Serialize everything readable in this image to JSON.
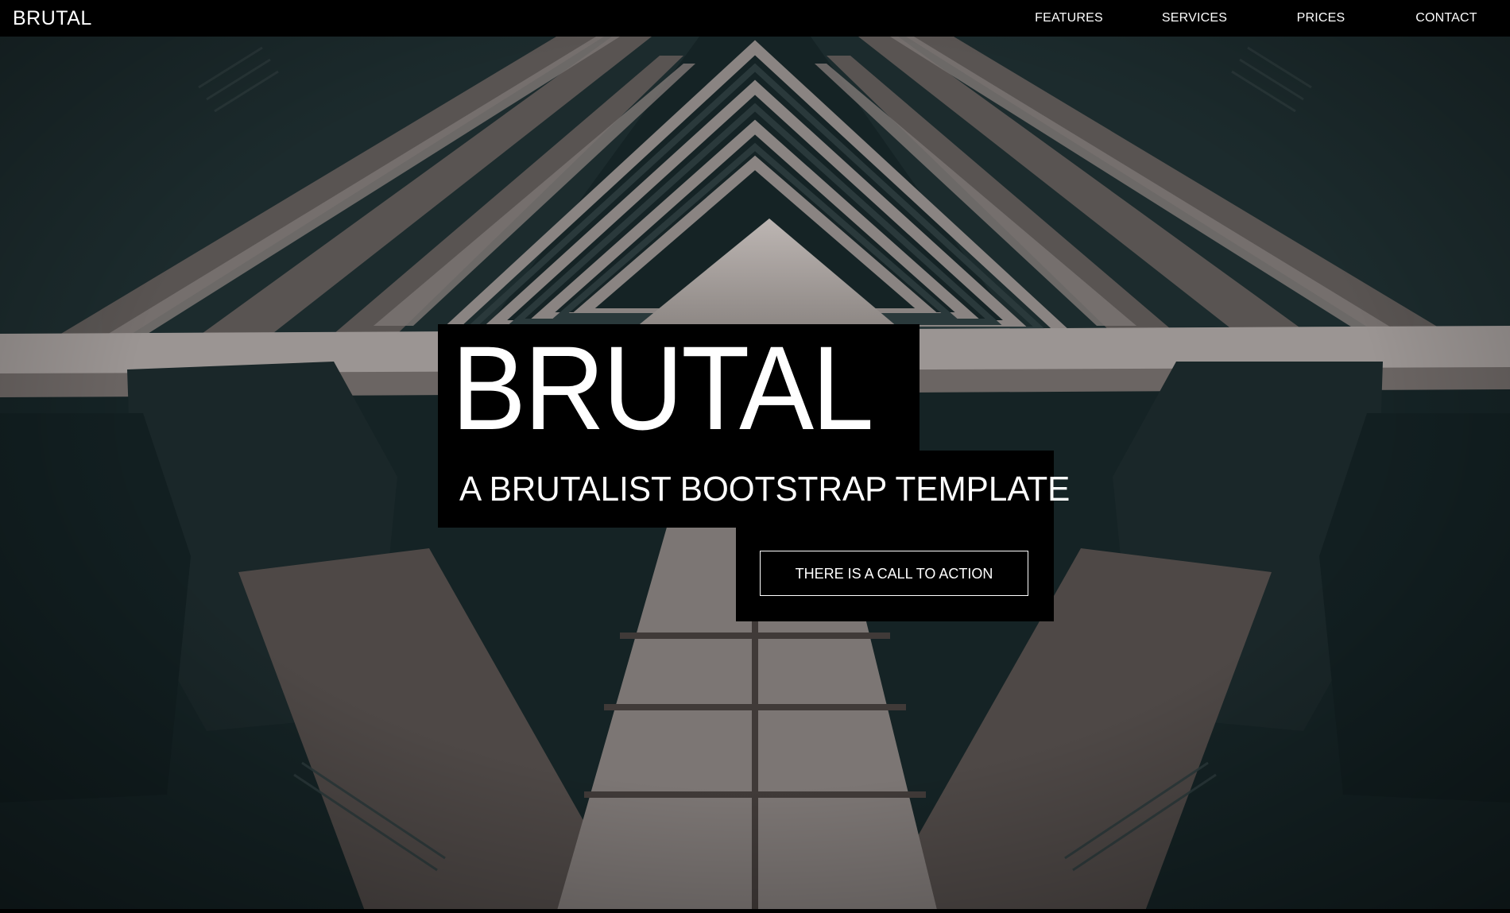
{
  "navbar": {
    "brand": "BRUTAL",
    "links": [
      {
        "label": "FEATURES"
      },
      {
        "label": "SERVICES"
      },
      {
        "label": "PRICES"
      },
      {
        "label": "CONTACT"
      }
    ]
  },
  "hero": {
    "title": "BRUTAL",
    "subtitle": "A BRUTALIST BOOTSTRAP TEMPLATE",
    "cta_label": "THERE IS A CALL TO ACTION"
  },
  "colors": {
    "navbar_bg": "#000000",
    "block_bg": "#000000",
    "text": "#ffffff",
    "photo_shadow": "#132224",
    "photo_concrete": "#6e6866"
  },
  "background_image": {
    "icon": "brutalist-building-photo"
  }
}
